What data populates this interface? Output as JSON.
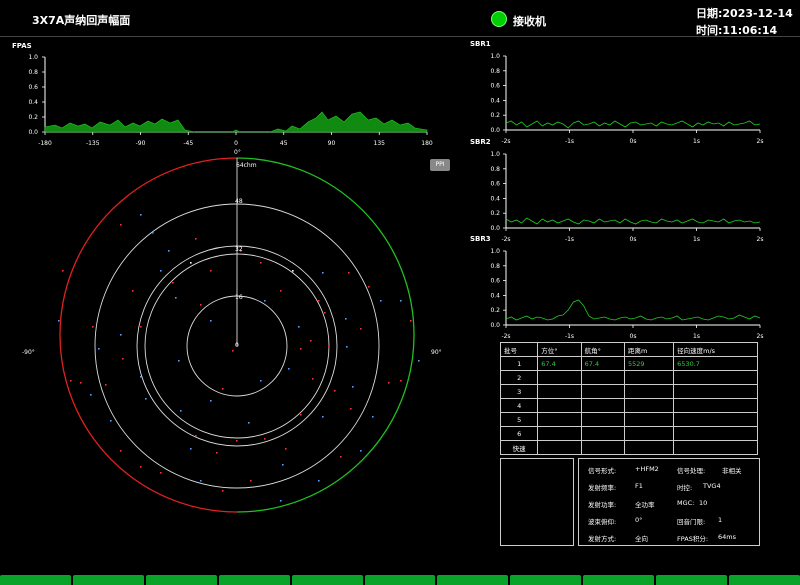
{
  "header": {
    "title": "3X7A声纳回声幅面",
    "status_label": "接收机",
    "status_color": "#00d000",
    "date_label": "日期:",
    "date": "2023-12-14",
    "time_label": "时间:",
    "time": "11:06:14"
  },
  "fpas": {
    "title": "FPAS",
    "yticks": [
      "1.0",
      "0.8",
      "0.6",
      "0.4",
      "0.2",
      "0.0"
    ],
    "xticks": [
      "-180",
      "-135",
      "-90",
      "-45",
      "0",
      "45",
      "90",
      "135",
      "180"
    ]
  },
  "sbr": [
    {
      "title": "SBR1",
      "yticks": [
        "1.0",
        "0.8",
        "0.6",
        "0.4",
        "0.2",
        "0.0"
      ],
      "xticks": [
        "-2s",
        "-1s",
        "0s",
        "1s",
        "2s"
      ]
    },
    {
      "title": "SBR2",
      "yticks": [
        "1.0",
        "0.8",
        "0.6",
        "0.4",
        "0.2",
        "0.0"
      ],
      "xticks": [
        "-2s",
        "-1s",
        "0s",
        "1s",
        "2s"
      ]
    },
    {
      "title": "SBR3",
      "yticks": [
        "1.0",
        "0.8",
        "0.6",
        "0.4",
        "0.2",
        "0.0"
      ],
      "xticks": [
        "-2s",
        "-1s",
        "0s",
        "1s",
        "2s"
      ]
    }
  ],
  "ppi": {
    "button_label": "PPI",
    "top_label": "0°",
    "left_label": "-90°",
    "right_label": "90°",
    "range_unit": "64chm",
    "rings": [
      "48",
      "32",
      "16",
      "0"
    ]
  },
  "track_table": {
    "headers": [
      "批号",
      "方位°",
      "航角°",
      "距离m",
      "径向速度m/s"
    ],
    "rows": [
      [
        "1",
        "67.4",
        "67.4",
        "5529",
        "6530.7"
      ],
      [
        "2",
        "",
        "",
        "",
        ""
      ],
      [
        "3",
        "",
        "",
        "",
        ""
      ],
      [
        "4",
        "",
        "",
        "",
        ""
      ],
      [
        "5",
        "",
        "",
        "",
        ""
      ],
      [
        "6",
        "",
        "",
        "",
        ""
      ],
      [
        "快速",
        "",
        "",
        "",
        ""
      ]
    ]
  },
  "params": {
    "signal_form_label": "信号形式:",
    "signal_form": "+HFM2",
    "signal_proc_label": "信号处理:",
    "signal_proc": "非相关",
    "tx_freq_label": "发射频率:",
    "tx_freq": "F1",
    "tvg_label": "时控:",
    "tvg": "TVG4",
    "tx_power_label": "发射功率:",
    "tx_power": "全功率",
    "mgc_label": "MGC:",
    "mgc": "10",
    "beam_tilt_label": "波束俯仰:",
    "beam_tilt": "0°",
    "echo_gate_label": "回音门限:",
    "echo_gate": "1",
    "tx_mode_label": "发射方式:",
    "tx_mode": "全向",
    "fpas_int_label": "FPAS积分:",
    "fpas_int": "64ms"
  },
  "colors": {
    "plot_fill": "#108a10",
    "plot_line": "#22cc22",
    "ring_left": "#e02020",
    "ring_right": "#20c020"
  }
}
